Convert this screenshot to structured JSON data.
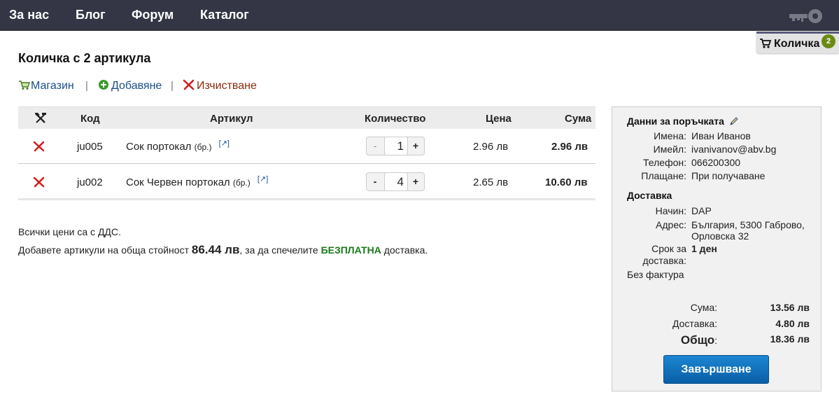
{
  "nav": {
    "items": [
      "За нас",
      "Блог",
      "Форум",
      "Каталог"
    ]
  },
  "cart_tab": {
    "label": "Количка",
    "count": "2"
  },
  "page": {
    "title": "Количка с 2 артикула"
  },
  "actions": {
    "shop": "Магазин",
    "add": "Добавяне",
    "clear": "Изчистване",
    "separator": "|"
  },
  "table": {
    "headers": {
      "code": "Код",
      "item": "Артикул",
      "quantity": "Количество",
      "price": "Цена",
      "sum": "Сума"
    },
    "rows": [
      {
        "code": "ju005",
        "name": "Сок портокал",
        "unit": "(бр.)",
        "ext": "[↗]",
        "qty": "1",
        "price": "2.96 лв",
        "sum": "2.96 лв"
      },
      {
        "code": "ju002",
        "name": "Сок Червен портокал",
        "unit": "(бр.)",
        "ext": "[↗]",
        "qty": "4",
        "price": "2.65 лв",
        "sum": "10.60 лв"
      }
    ],
    "qty_minus": "-",
    "qty_plus": "+"
  },
  "notes": {
    "vat": "Всички цени са с ДДС.",
    "free_before": "Добавете артикули на обща стойност ",
    "free_amount": "86.44 лв",
    "free_middle": ", за да спечелите ",
    "free_word": "БЕЗПЛАТНА",
    "free_after": " доставка."
  },
  "summary": {
    "order_title": "Данни за поръчката",
    "name_label": "Имена:",
    "name_value": "Иван Иванов",
    "email_label": "Имейл:",
    "email_value": "ivanivanov@abv.bg",
    "phone_label": "Телефон:",
    "phone_value": "066200300",
    "payment_label": "Плащане:",
    "payment_value": "При получаване",
    "delivery_title": "Доставка",
    "method_label": "Начин:",
    "method_value": "DAP",
    "address_label": "Адрес:",
    "address_line1": "България, 5300 Габрово,",
    "address_line2": "Орловска 32",
    "term_label_1": "Срок за",
    "term_label_2": "доставка:",
    "term_value": "1 ден",
    "invoice": "Без фактура",
    "sum_label": "Сума:",
    "sum_value": "13.56 лв",
    "delivery_label": "Доставка:",
    "delivery_value": "4.80 лв",
    "total_label": "Общо",
    "total_colon": ":",
    "total_value": "18.36 лв",
    "finish_button": "Завършване"
  },
  "colors": {
    "nav_bg": "#343545",
    "link_blue": "#1a4e8a",
    "free_green": "#1a7a1a",
    "button_blue": "#0a6ab8",
    "badge_green": "#6a8a12"
  }
}
